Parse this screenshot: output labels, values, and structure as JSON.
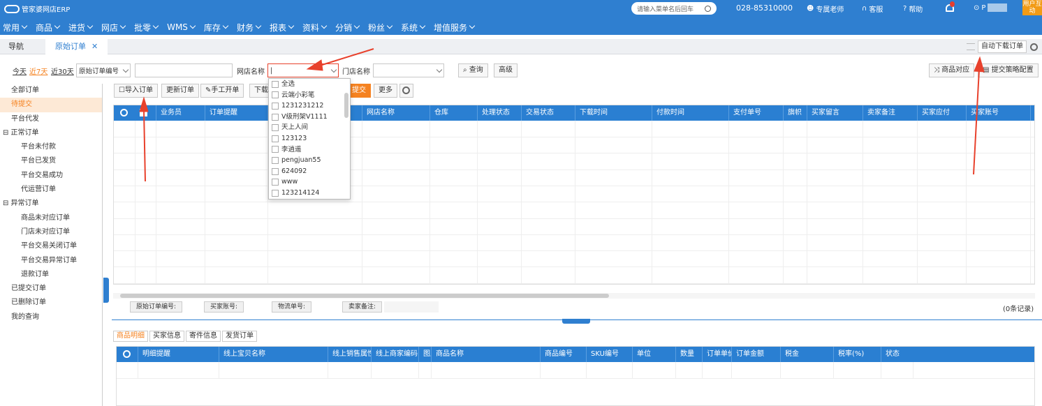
{
  "app": {
    "title": "管家婆网店ERP"
  },
  "top": {
    "search_placeholder": "请输入菜单名后回车",
    "phone": "028-85310000",
    "teacher": "专属老师",
    "service": "客服",
    "help": "帮助",
    "user_name": "P",
    "user_btn": "用户互动"
  },
  "nav": {
    "items": [
      "常用",
      "商品",
      "进货",
      "网店",
      "批零",
      "WMS",
      "库存",
      "财务",
      "报表",
      "资料",
      "分销",
      "粉丝",
      "系统",
      "增值服务"
    ]
  },
  "tabs": {
    "nav": "导航",
    "current": "原始订单",
    "auto_download": "自动下载订单"
  },
  "filter": {
    "today": "今天",
    "last7": "近7天",
    "last30": "近30天",
    "field_select": "原始订单编号",
    "value": "",
    "shop_label": "网店名称",
    "shop_value": "|",
    "store_label": "门店名称",
    "store_value": "",
    "query": "查询",
    "advanced": "高级",
    "product_match": "商品对应",
    "submit_config": "提交策略配置"
  },
  "toolbar": {
    "import": "导入订单",
    "update": "更新订单",
    "manual": "手工开单",
    "download": "下载",
    "submit": "提交",
    "more": "更多"
  },
  "sidebar": {
    "items": [
      {
        "label": "全部订单",
        "level": 1,
        "active": false
      },
      {
        "label": "待提交",
        "level": 1,
        "active": true
      },
      {
        "label": "平台代发",
        "level": 1,
        "active": false
      },
      {
        "label": "⊟ 正常订单",
        "level": 0,
        "active": false
      },
      {
        "label": "平台未付款",
        "level": 2,
        "active": false
      },
      {
        "label": "平台已发货",
        "level": 2,
        "active": false
      },
      {
        "label": "平台交易成功",
        "level": 2,
        "active": false
      },
      {
        "label": "代运营订单",
        "level": 2,
        "active": false
      },
      {
        "label": "⊟ 异常订单",
        "level": 0,
        "active": false
      },
      {
        "label": "商品未对应订单",
        "level": 2,
        "active": false
      },
      {
        "label": "门店未对应订单",
        "level": 2,
        "active": false
      },
      {
        "label": "平台交易关闭订单",
        "level": 2,
        "active": false
      },
      {
        "label": "平台交易异常订单",
        "level": 2,
        "active": false
      },
      {
        "label": "退款订单",
        "level": 2,
        "active": false
      },
      {
        "label": "已提交订单",
        "level": 1,
        "active": false
      },
      {
        "label": "已删除订单",
        "level": 1,
        "active": false
      },
      {
        "label": "我的查询",
        "level": 1,
        "active": false
      }
    ]
  },
  "grid": {
    "columns": [
      "业务员",
      "订单提醒",
      "",
      "网店名称",
      "仓库",
      "处理状态",
      "交易状态",
      "下载时间",
      "付款时间",
      "支付单号",
      "旗帜",
      "买家留言",
      "卖家备注",
      "买家应付",
      "买家账号",
      "买"
    ]
  },
  "footer": {
    "order_no": "原始订单编号:",
    "buyer": "买家账号:",
    "logistics": "物流单号:",
    "seller_note": "卖家备注:",
    "records": "(0条记录)"
  },
  "bottom_tabs": [
    "商品明细",
    "买家信息",
    "寄件信息",
    "发货订单"
  ],
  "detail": {
    "columns": [
      "明细提醒",
      "线上宝贝名称",
      "线上销售属性",
      "线上商家编码",
      "图片",
      "商品名称",
      "商品编号",
      "SKU编号",
      "单位",
      "数量",
      "订单单价",
      "订单金额",
      "税金",
      "税率(%)",
      "状态"
    ]
  },
  "dropdown": {
    "options": [
      "全选",
      "云端小彩笔",
      "1231231212",
      "V级刑架V1111",
      "天上人间",
      "123123",
      "李逍遥",
      "pengjuan55",
      "624092",
      "www",
      "123214124"
    ]
  },
  "colors": {
    "primary": "#2f7fd0",
    "accent": "#f58220",
    "header": "#2a7fd2",
    "arrow": "#e8412c",
    "user_btn": "#f29b16"
  }
}
